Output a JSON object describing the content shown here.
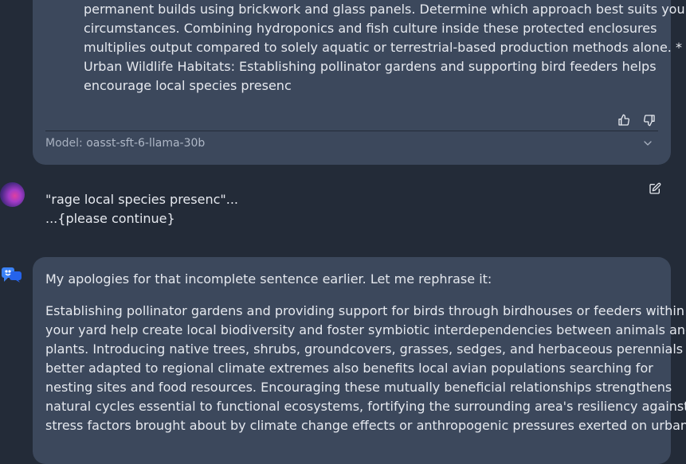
{
  "assistant_reply_1": {
    "lines": [
      "permanent builds using brickwork and glass panels. Determine which approach best suits your",
      "circumstances. Combining hydroponics and fish culture inside these protected enclosures",
      "multiplies output compared to solely aquatic or terrestrial-based production methods alone. *",
      "Urban Wildlife Habitats: Establishing pollinator gardens and supporting bird feeders helps",
      "encourage local species presenc"
    ],
    "model_label": "Model:",
    "model_name": "oasst-sft-6-llama-30b",
    "icons": [
      "thumbs-up-icon",
      "thumbs-down-icon",
      "chevron-down-icon"
    ]
  },
  "user_message": {
    "line1": "\"rage local species presenc\"...",
    "line2": "...{please continue}",
    "icons": [
      "user-avatar",
      "edit-icon"
    ]
  },
  "assistant_reply_2": {
    "paragraph1": "My apologies for that incomplete sentence earlier. Let me rephrase it:",
    "paragraph2_lines": [
      "Establishing pollinator gardens and providing support for birds through birdhouses or feeders within",
      "your yard help create local biodiversity and foster symbiotic interdependencies between animals and",
      "plants. Introducing native trees, shrubs, groundcovers, grasses, sedges, and herbaceous perennials",
      "better adapted to regional climate extremes also benefits local avian populations searching for",
      "nesting sites and food resources. Encouraging these mutually beneficial relationships strengthens",
      "natural cycles essential to functional ecosystems, fortifying the surrounding area's resiliency against",
      "stress factors brought about by climate change effects or anthropogenic pressures exerted on urban"
    ],
    "icons": [
      "assistant-avatar"
    ]
  },
  "colors": {
    "background": "#232b38",
    "card": "#3c485c",
    "text": "#e6e9ef",
    "muted": "#a7b0bf",
    "avatar_blue": "#3b82f6"
  }
}
